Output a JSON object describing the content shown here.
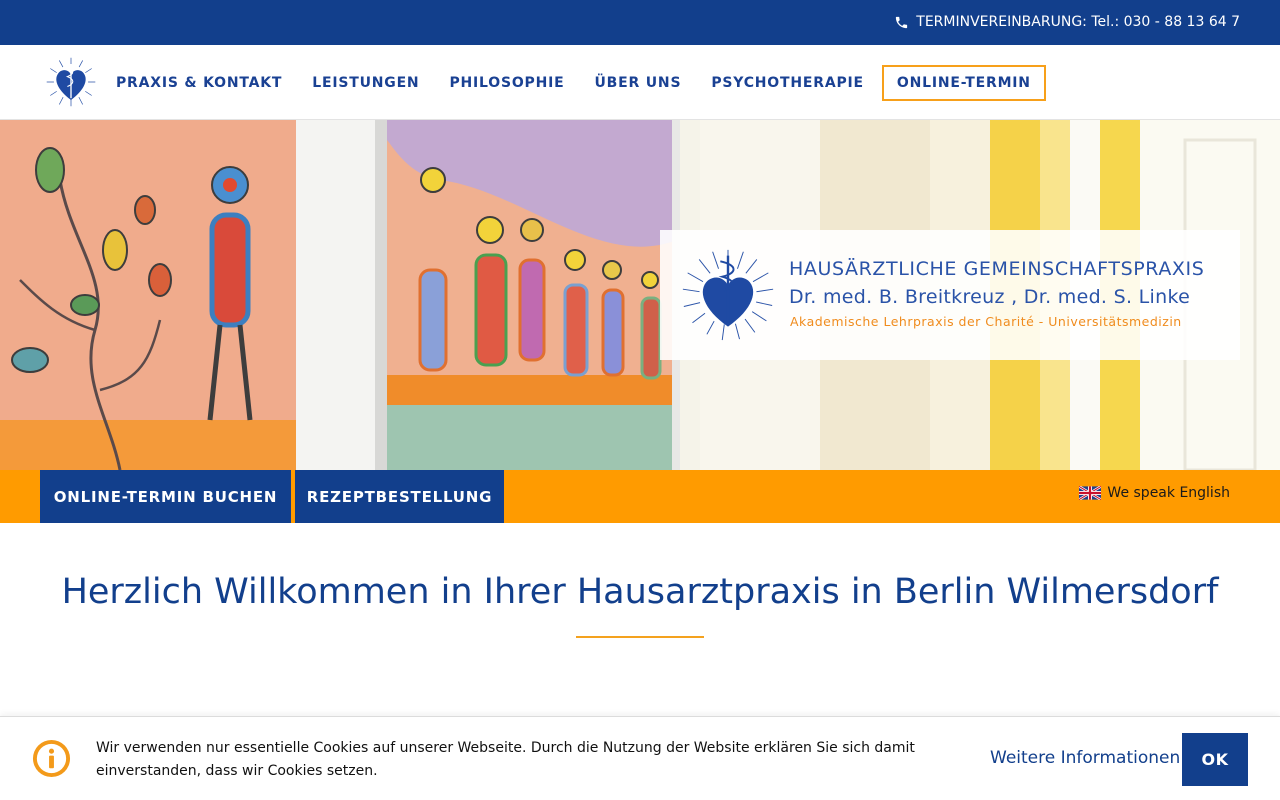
{
  "topbar": {
    "phone_text": "TERMINVEREINBARUNG: Tel.: 030 - 88 13 64 7",
    "phone_icon": "phone-icon"
  },
  "nav": {
    "logo_icon": "heart-caduceus-logo",
    "items": [
      {
        "label": "PRAXIS & KONTAKT"
      },
      {
        "label": "LEISTUNGEN"
      },
      {
        "label": "PHILOSOPHIE"
      },
      {
        "label": "ÜBER UNS"
      },
      {
        "label": "PSYCHOTHERAPIE"
      },
      {
        "label": "ONLINE-TERMIN",
        "highlighted": true
      }
    ]
  },
  "hero": {
    "brand_line1": "HAUSÄRZTLICHE GEMEINSCHAFTSPRAXIS",
    "brand_line2": "Dr. med. B. Breitkreuz , Dr. med. S. Linke",
    "brand_line3": "Akademische Lehrpraxis der Charité - Universitätsmedizin"
  },
  "cta": {
    "book_label": "ONLINE-TERMIN BUCHEN",
    "prescription_label": "REZEPTBESTELLUNG",
    "english_label": "We speak English",
    "english_icon": "uk-flag-icon"
  },
  "main": {
    "title": "Herzlich Willkommen in Ihrer Hausarztpraxis in Berlin Wilmersdorf"
  },
  "cookie": {
    "text": "Wir verwenden nur essentielle Cookies auf unserer Webseite. Durch die Nutzung der Website erklären Sie sich damit einverstanden, dass wir Cookies setzen.",
    "more_label": "Weitere Informationen",
    "ok_label": "OK",
    "info_icon": "info-icon"
  },
  "colors": {
    "primary_blue": "#123f8c",
    "accent_orange": "#ff9b00",
    "text_blue": "#1a4193"
  }
}
